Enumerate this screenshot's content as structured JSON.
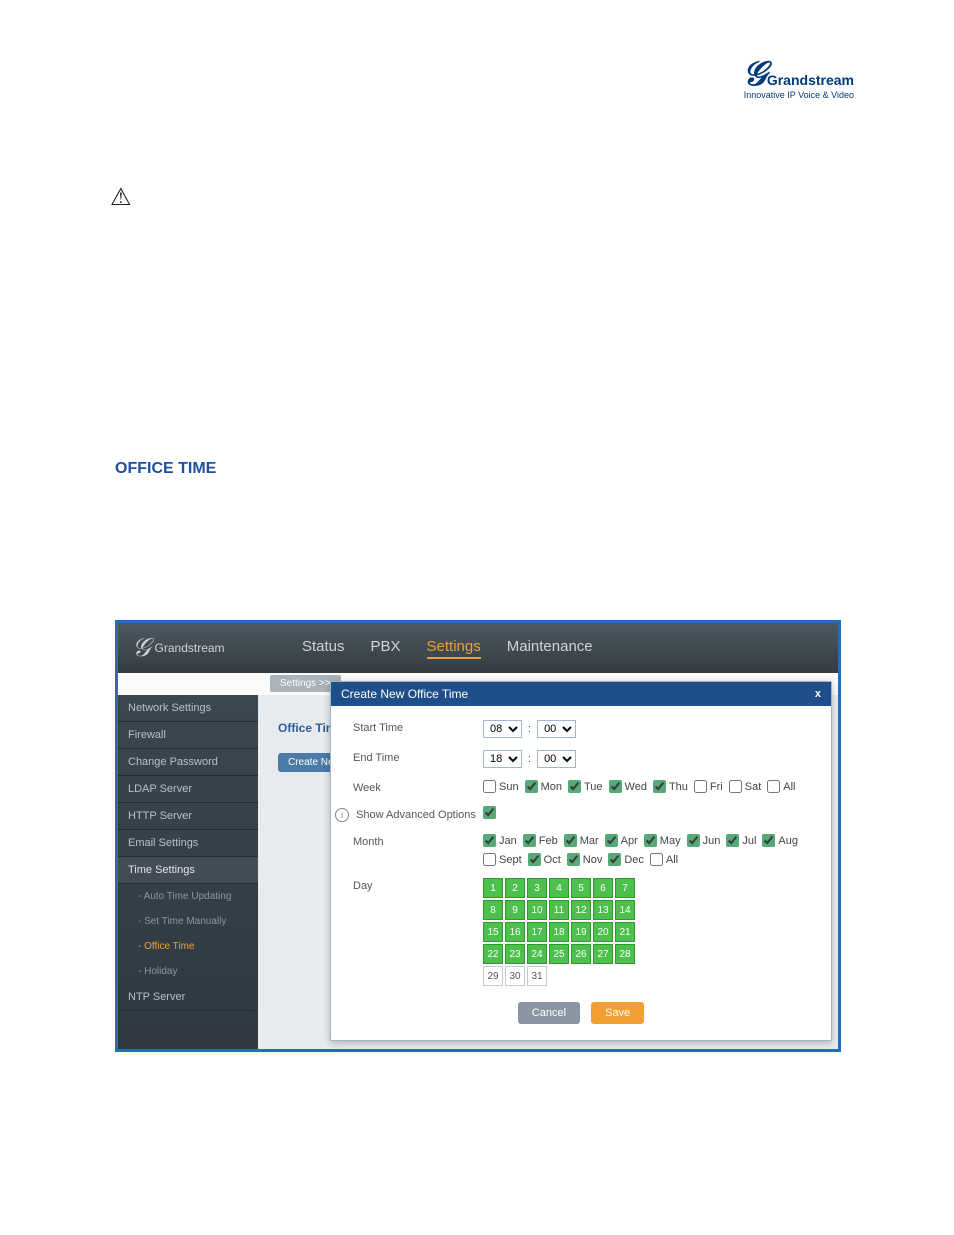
{
  "brand": {
    "name": "Grandstream",
    "tagline": "Innovative IP Voice & Video"
  },
  "section_heading": "OFFICE TIME",
  "shot": {
    "nav_tabs": {
      "status": "Status",
      "pbx": "PBX",
      "settings": "Settings",
      "maintenance": "Maintenance"
    },
    "breadcrumb": "Settings >>",
    "sidebar": {
      "items": {
        "network": "Network Settings",
        "firewall": "Firewall",
        "changepw": "Change Password",
        "ldap": "LDAP Server",
        "http": "HTTP Server",
        "email": "Email Settings",
        "time": "Time Settings",
        "ntp": "NTP Server"
      },
      "time_children": {
        "auto": "Auto Time Updating",
        "manual": "Set Time Manually",
        "office": "Office Time",
        "holiday": "Holiday"
      }
    },
    "mid": {
      "label": "Office Time",
      "button": "Create Ne"
    },
    "dialog": {
      "title": "Create New Office Time",
      "close": "x",
      "labels": {
        "start": "Start Time",
        "end": "End Time",
        "week": "Week",
        "advanced": "Show Advanced Options",
        "month": "Month",
        "day": "Day"
      },
      "start": {
        "hour": "08",
        "minute": "00"
      },
      "end": {
        "hour": "18",
        "minute": "00"
      },
      "colon": ":",
      "week": {
        "opts": [
          {
            "label": "Sun",
            "checked": false
          },
          {
            "label": "Mon",
            "checked": true
          },
          {
            "label": "Tue",
            "checked": true
          },
          {
            "label": "Wed",
            "checked": true
          },
          {
            "label": "Thu",
            "checked": true
          },
          {
            "label": "Fri",
            "checked": false
          },
          {
            "label": "Sat",
            "checked": false
          },
          {
            "label": "All",
            "checked": false
          }
        ]
      },
      "advanced_checked": true,
      "month": {
        "opts": [
          {
            "label": "Jan",
            "checked": true
          },
          {
            "label": "Feb",
            "checked": true
          },
          {
            "label": "Mar",
            "checked": true
          },
          {
            "label": "Apr",
            "checked": true
          },
          {
            "label": "May",
            "checked": true
          },
          {
            "label": "Jun",
            "checked": true
          },
          {
            "label": "Jul",
            "checked": true
          },
          {
            "label": "Aug",
            "checked": true
          },
          {
            "label": "Sept",
            "checked": false
          },
          {
            "label": "Oct",
            "checked": true
          },
          {
            "label": "Nov",
            "checked": true
          },
          {
            "label": "Dec",
            "checked": true
          },
          {
            "label": "All",
            "checked": false
          }
        ]
      },
      "days_selected_through": 28,
      "days_total": 31,
      "buttons": {
        "cancel": "Cancel",
        "save": "Save"
      }
    }
  }
}
